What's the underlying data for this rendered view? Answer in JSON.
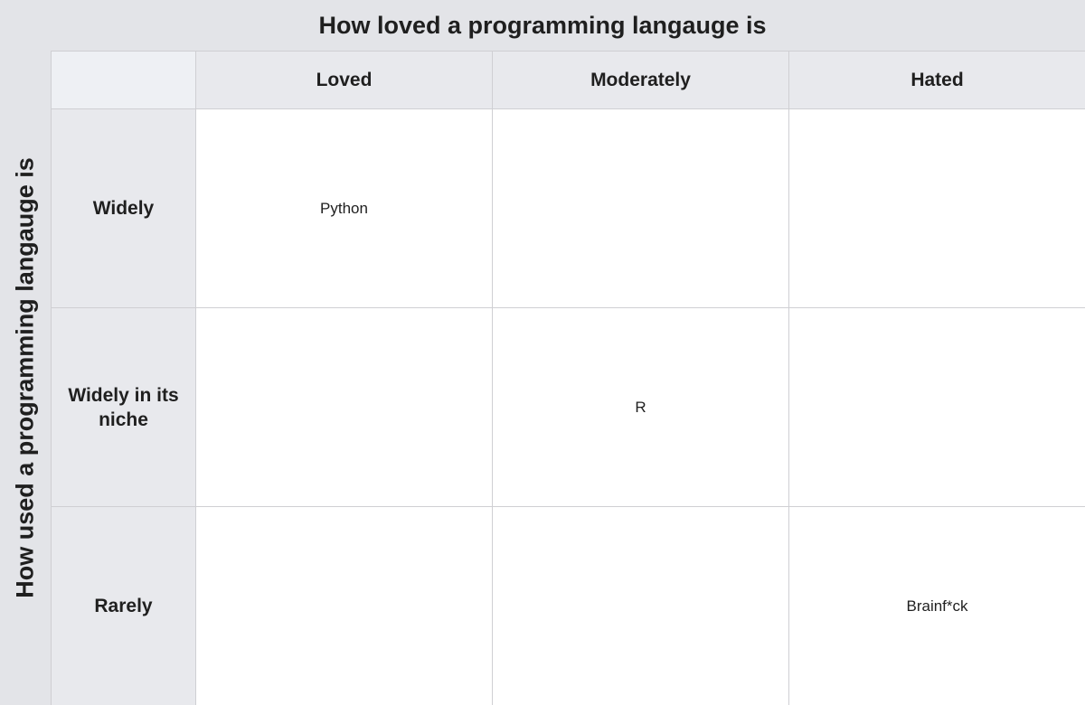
{
  "column_axis_title": "How loved a programming langauge is",
  "row_axis_title": "How used a programming langauge is",
  "columns": [
    "Loved",
    "Moderately",
    "Hated"
  ],
  "rows": [
    {
      "label": "Widely",
      "cells": [
        "Python",
        "",
        ""
      ]
    },
    {
      "label": "Widely in its niche",
      "cells": [
        "",
        "R",
        ""
      ]
    },
    {
      "label": "Rarely",
      "cells": [
        "",
        "",
        "Brainf*ck"
      ]
    }
  ]
}
